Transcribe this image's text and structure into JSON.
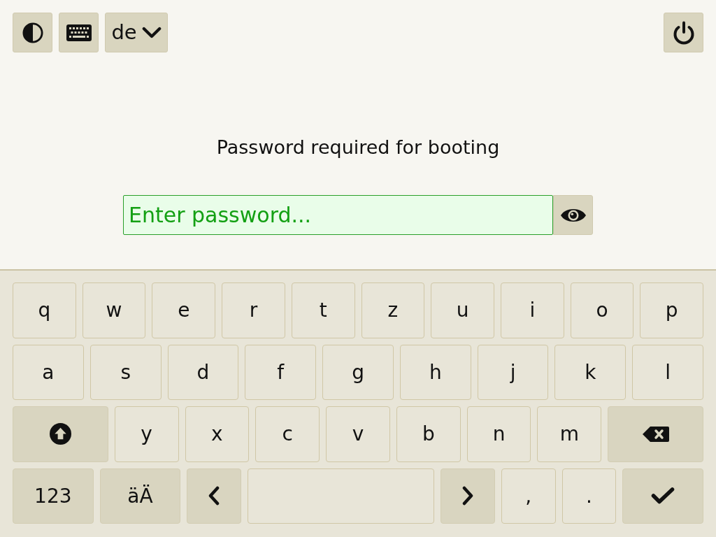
{
  "toolbar": {
    "language": {
      "label": "de"
    }
  },
  "prompt": {
    "title": "Password required for booting",
    "password_field": {
      "placeholder": "Enter password..."
    }
  },
  "keyboard": {
    "rows": [
      {
        "keys": [
          {
            "kind": "char",
            "label": "q"
          },
          {
            "kind": "char",
            "label": "w"
          },
          {
            "kind": "char",
            "label": "e"
          },
          {
            "kind": "char",
            "label": "r"
          },
          {
            "kind": "char",
            "label": "t"
          },
          {
            "kind": "char",
            "label": "z"
          },
          {
            "kind": "char",
            "label": "u"
          },
          {
            "kind": "char",
            "label": "i"
          },
          {
            "kind": "char",
            "label": "o"
          },
          {
            "kind": "char",
            "label": "p"
          }
        ]
      },
      {
        "keys": [
          {
            "kind": "char",
            "label": "a"
          },
          {
            "kind": "char",
            "label": "s"
          },
          {
            "kind": "char",
            "label": "d"
          },
          {
            "kind": "char",
            "label": "f"
          },
          {
            "kind": "char",
            "label": "g"
          },
          {
            "kind": "char",
            "label": "h"
          },
          {
            "kind": "char",
            "label": "j"
          },
          {
            "kind": "char",
            "label": "k"
          },
          {
            "kind": "char",
            "label": "l"
          }
        ]
      },
      {
        "keys": [
          {
            "kind": "shift"
          },
          {
            "kind": "char",
            "label": "y"
          },
          {
            "kind": "char",
            "label": "x"
          },
          {
            "kind": "char",
            "label": "c"
          },
          {
            "kind": "char",
            "label": "v"
          },
          {
            "kind": "char",
            "label": "b"
          },
          {
            "kind": "char",
            "label": "n"
          },
          {
            "kind": "char",
            "label": "m"
          },
          {
            "kind": "backspace"
          }
        ]
      },
      {
        "keys": [
          {
            "kind": "symbols",
            "label": "123"
          },
          {
            "kind": "accents",
            "label": "äÄ"
          },
          {
            "kind": "left"
          },
          {
            "kind": "space"
          },
          {
            "kind": "right"
          },
          {
            "kind": "char",
            "label": ","
          },
          {
            "kind": "char",
            "label": "."
          },
          {
            "kind": "enter"
          }
        ]
      }
    ]
  }
}
